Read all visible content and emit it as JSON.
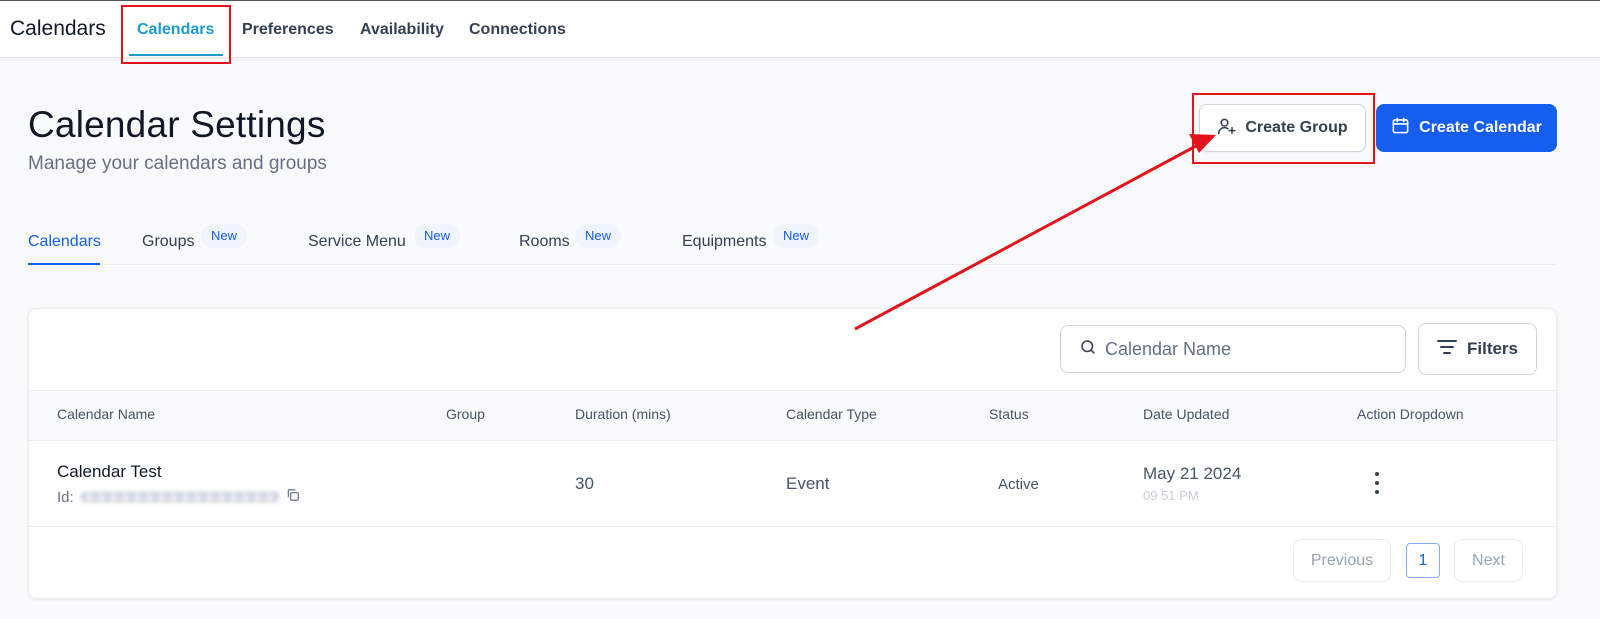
{
  "app": {
    "title": "Calendars"
  },
  "topnav": {
    "tabs": [
      "Calendars",
      "Preferences",
      "Availability",
      "Connections"
    ]
  },
  "header": {
    "title": "Calendar Settings",
    "subtitle": "Manage your calendars and groups"
  },
  "actions": {
    "create_group": "Create Group",
    "create_calendar": "Create Calendar"
  },
  "subtabs": [
    {
      "label": "Calendars"
    },
    {
      "label": "Groups",
      "badge": "New"
    },
    {
      "label": "Service Menu",
      "badge": "New"
    },
    {
      "label": "Rooms",
      "badge": "New"
    },
    {
      "label": "Equipments",
      "badge": "New"
    }
  ],
  "toolbar": {
    "search_placeholder": "Calendar Name",
    "filters_label": "Filters"
  },
  "table": {
    "columns": [
      "Calendar Name",
      "Group",
      "Duration (mins)",
      "Calendar Type",
      "Status",
      "Date Updated",
      "Action Dropdown"
    ],
    "rows": [
      {
        "name": "Calendar Test",
        "id_label": "Id:",
        "group": "",
        "duration": "30",
        "type": "Event",
        "status": "Active",
        "date": "May 21 2024",
        "time": "09 51 PM"
      }
    ]
  },
  "pagination": {
    "previous": "Previous",
    "page": "1",
    "next": "Next"
  },
  "annotation": {
    "color": "#e3141b"
  }
}
